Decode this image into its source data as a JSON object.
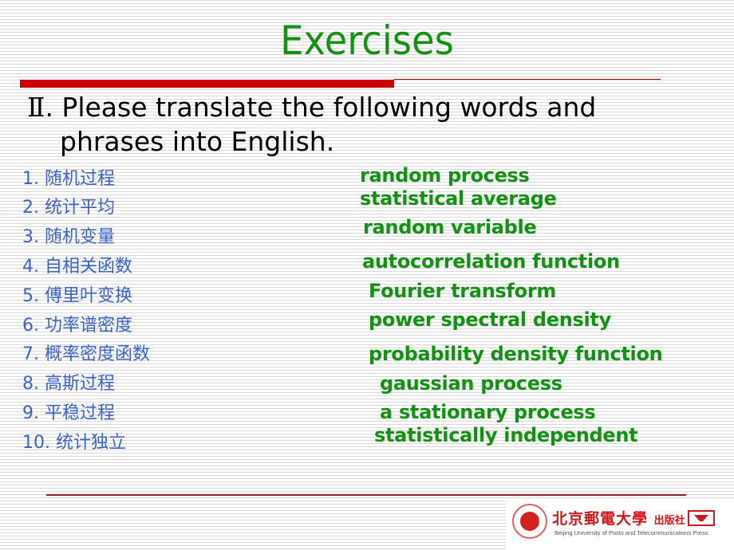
{
  "slide": {
    "title": "Exercises",
    "instruction": {
      "numeral": "Ⅱ",
      "line1": ". Please translate the following words and",
      "line2": "phrases  into English."
    },
    "chinese_terms": [
      "1. 随机过程",
      "2. 统计平均",
      "3. 随机变量",
      "4. 自相关函数",
      "5. 傅里叶变换",
      "6. 功率谱密度",
      "7. 概率密度函数",
      "8. 高斯过程",
      "9. 平稳过程",
      "10. 统计独立"
    ],
    "english_terms": [
      "random process",
      "statistical average",
      "random variable",
      "autocorrelation function",
      "Fourier transform",
      "power spectral density",
      "probability density function",
      "gaussian process",
      "a stationary process",
      "statistically independent"
    ]
  },
  "footer": {
    "publisher_cn": "北京郵電大學",
    "publisher_cn_suffix": "出版社",
    "publisher_en": "Beijing University of Posts and Telecommunications Press"
  },
  "colors": {
    "title": "#119311",
    "accent_red": "#cc0000",
    "chinese_text": "#3a62c8",
    "english_text": "#119311"
  }
}
